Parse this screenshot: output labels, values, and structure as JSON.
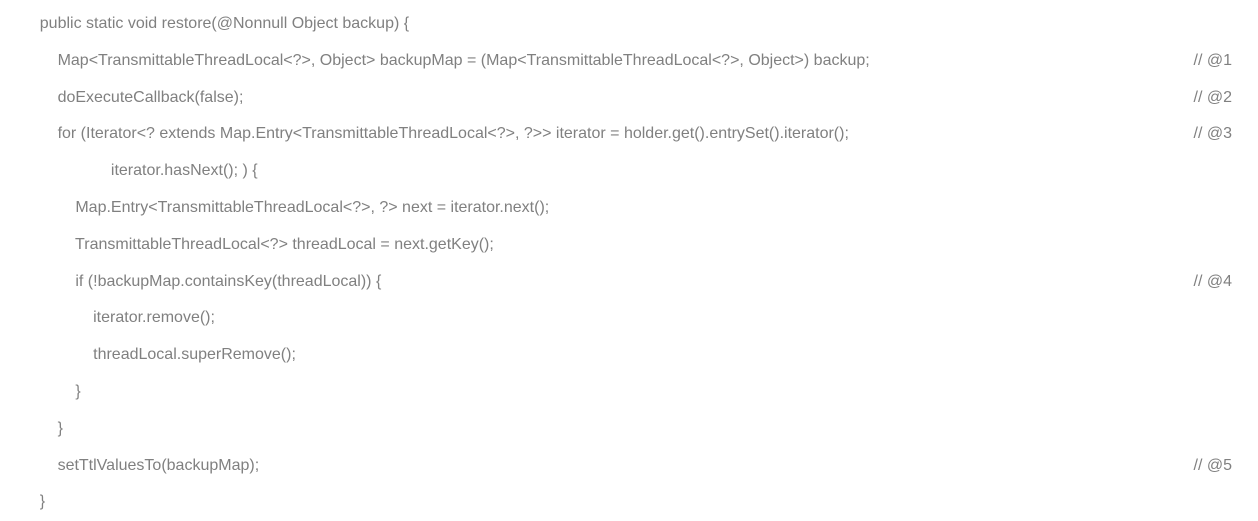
{
  "code": {
    "lines": [
      {
        "indent": 1,
        "text": "public static void restore(@Nonnull Object backup) {",
        "comment": ""
      },
      {
        "indent": 2,
        "text": "Map<TransmittableThreadLocal<?>, Object> backupMap = (Map<TransmittableThreadLocal<?>, Object>) backup;",
        "comment": "// @1"
      },
      {
        "indent": 2,
        "text": "doExecuteCallback(false);",
        "comment": "// @2"
      },
      {
        "indent": 2,
        "text": "for (Iterator<? extends Map.Entry<TransmittableThreadLocal<?>, ?>> iterator = holder.get().entrySet().iterator();",
        "comment": "// @3"
      },
      {
        "indent": 5,
        "text": "iterator.hasNext(); ) {",
        "comment": ""
      },
      {
        "indent": 3,
        "text": "Map.Entry<TransmittableThreadLocal<?>, ?> next = iterator.next();",
        "comment": ""
      },
      {
        "indent": 3,
        "text": "TransmittableThreadLocal<?> threadLocal = next.getKey();",
        "comment": ""
      },
      {
        "indent": 3,
        "text": "if (!backupMap.containsKey(threadLocal)) {",
        "comment": "// @4"
      },
      {
        "indent": 4,
        "text": "iterator.remove();",
        "comment": ""
      },
      {
        "indent": 4,
        "text": "threadLocal.superRemove();",
        "comment": ""
      },
      {
        "indent": 3,
        "text": "}",
        "comment": ""
      },
      {
        "indent": 2,
        "text": "}",
        "comment": ""
      },
      {
        "indent": 2,
        "text": "setTtlValuesTo(backupMap);",
        "comment": "// @5"
      },
      {
        "indent": 1,
        "text": "}",
        "comment": ""
      }
    ],
    "indent_unit": "    "
  }
}
